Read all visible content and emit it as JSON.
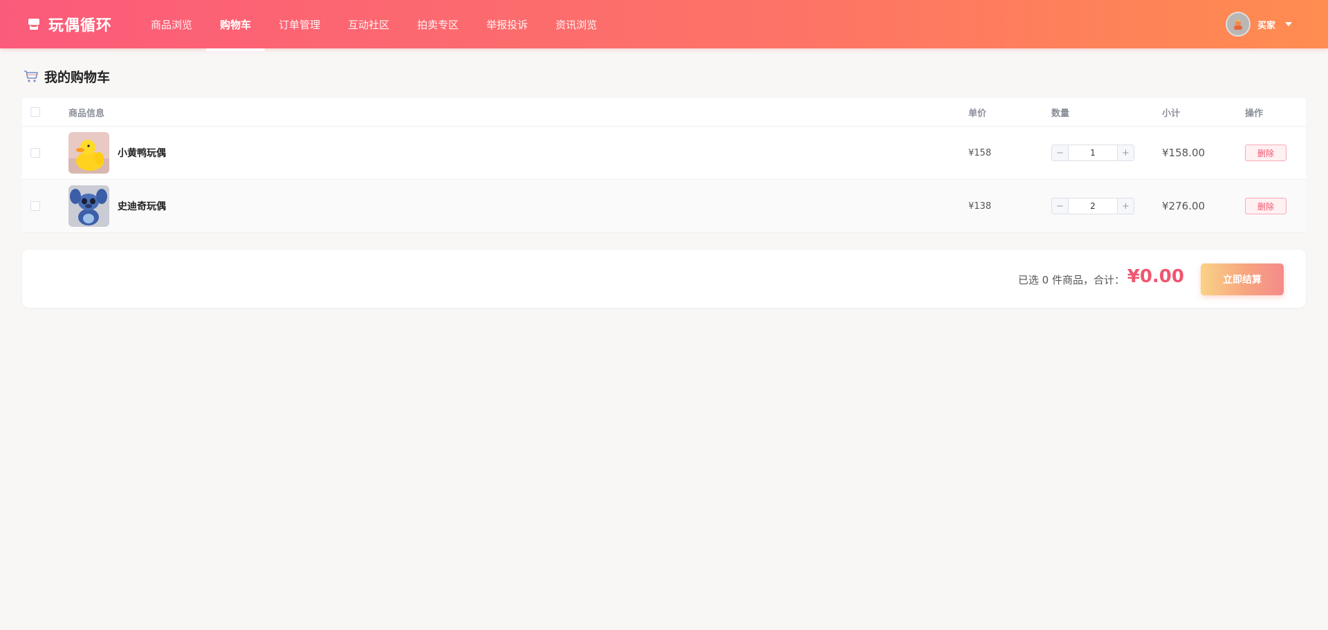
{
  "header": {
    "brand_name": "玩偶循环",
    "nav": [
      {
        "label": "商品浏览",
        "active": false
      },
      {
        "label": "购物车",
        "active": true
      },
      {
        "label": "订单管理",
        "active": false
      },
      {
        "label": "互动社区",
        "active": false
      },
      {
        "label": "拍卖专区",
        "active": false
      },
      {
        "label": "举报投诉",
        "active": false
      },
      {
        "label": "资讯浏览",
        "active": false
      }
    ],
    "user_name": "买家"
  },
  "page": {
    "title": "我的购物车"
  },
  "cart": {
    "headers": {
      "info": "商品信息",
      "price": "单价",
      "quantity": "数量",
      "subtotal": "小计",
      "actions": "操作"
    },
    "items": [
      {
        "name": "小黄鸭玩偶",
        "price": "¥158",
        "quantity": "1",
        "subtotal": "¥158.00",
        "delete_label": "删除",
        "thumb_icon": "yellow-duck-plush"
      },
      {
        "name": "史迪奇玩偶",
        "price": "¥138",
        "quantity": "2",
        "subtotal": "¥276.00",
        "delete_label": "删除",
        "thumb_icon": "stitch-plush"
      }
    ],
    "stepper": {
      "minus": "−",
      "plus": "+"
    }
  },
  "summary": {
    "text": "已选 0 件商品，合计：",
    "total": "¥0.00",
    "checkout_label": "立即结算"
  },
  "colors": {
    "header_gradient_start": "#fb5b7a",
    "header_gradient_end": "#ff8c50",
    "accent_red": "#f0566f"
  }
}
